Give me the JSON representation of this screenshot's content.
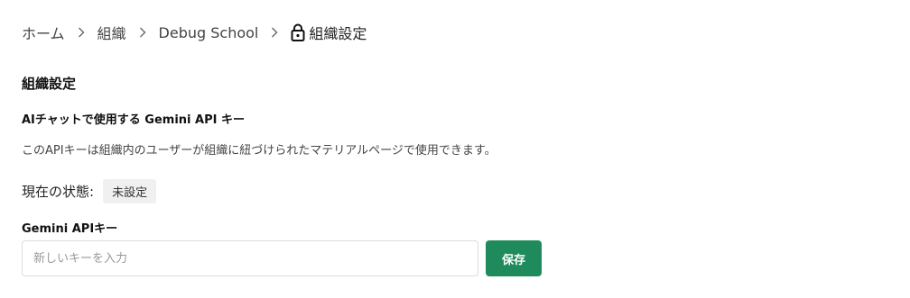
{
  "breadcrumb": {
    "home": "ホーム",
    "organization": "組織",
    "school": "Debug School",
    "current": "組織設定"
  },
  "section": {
    "title": "組織設定",
    "subtitle": "AIチャットで使用する Gemini API キー",
    "description": "このAPIキーは組織内のユーザーが組織に紐づけられたマテリアルページで使用できます。"
  },
  "status": {
    "label": "現在の状態:",
    "value": "未設定"
  },
  "form": {
    "label": "Gemini APIキー",
    "placeholder": "新しいキーを入力",
    "value": "",
    "save_label": "保存"
  },
  "colors": {
    "primary": "#1f8b5c",
    "badge_bg": "#f0f0f0"
  }
}
